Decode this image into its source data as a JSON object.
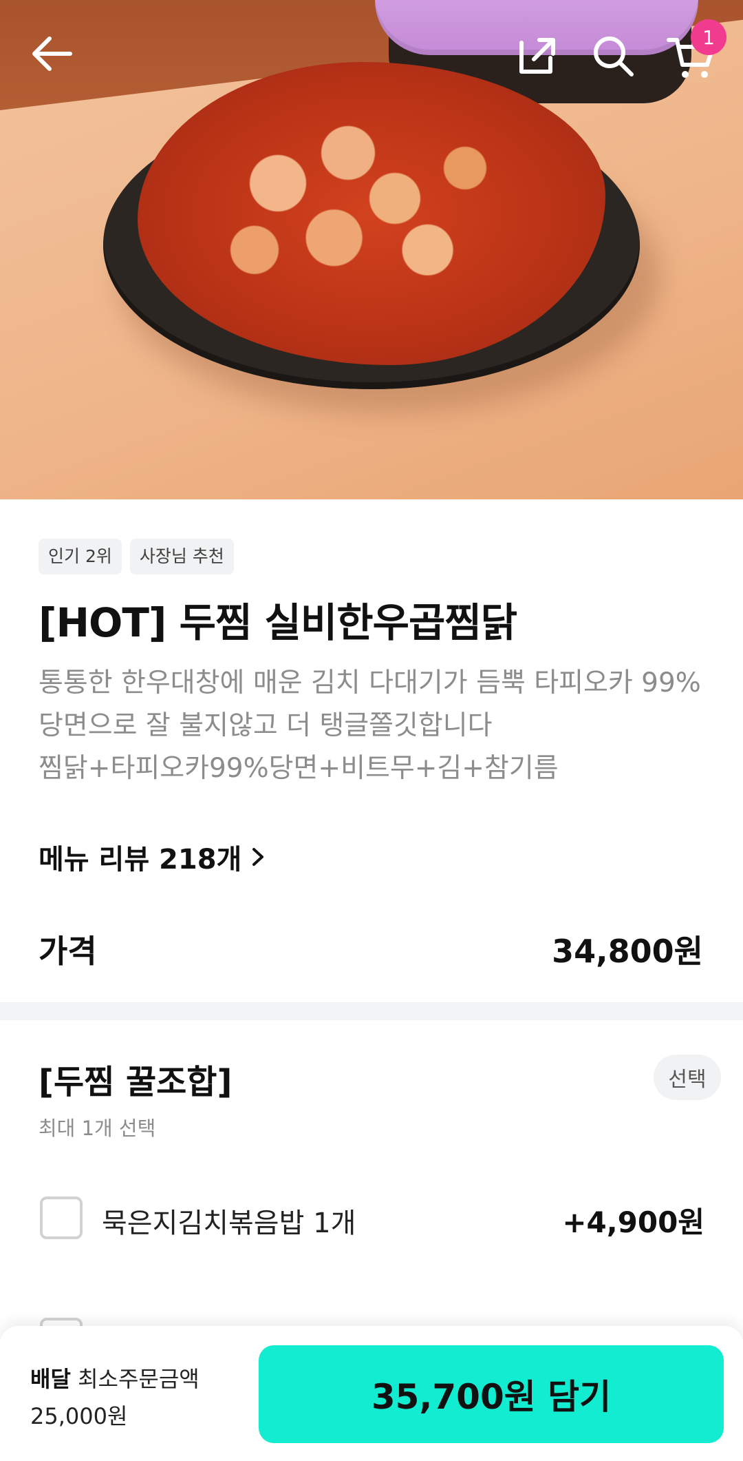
{
  "header": {
    "cart_count": "1"
  },
  "product": {
    "tags": [
      "인기 2위",
      "사장님 추천"
    ],
    "title": "[HOT] 두찜 실비한우곱찜닭",
    "description_lines": [
      "통통한 한우대창에 매운 김치 다대기가 듬뿍  타피오카 99%",
      "당면으로 잘 불지않고 더 탱글쫄깃합니다",
      "찜닭+타피오카99%당면+비트무+김+참기름"
    ],
    "review_link": "메뉴 리뷰 218개",
    "price_label": "가격",
    "price_value": "34,800원"
  },
  "option_group": {
    "title": "[두찜 꿀조합]",
    "subtitle": "최대 1개 선택",
    "badge": "선택",
    "items": [
      {
        "label": "묵은지김치볶음밥 1개",
        "price": "+4,900원",
        "checked": false
      },
      {
        "label": "",
        "price": "",
        "checked": false
      }
    ]
  },
  "bottom_bar": {
    "delivery_label": "배달",
    "min_order_label": "최소주문금액",
    "min_order_value": "25,000원",
    "cta_label": "35,700원 담기"
  },
  "colors": {
    "accent": "#12ecd0",
    "badge": "#f13b8e"
  }
}
